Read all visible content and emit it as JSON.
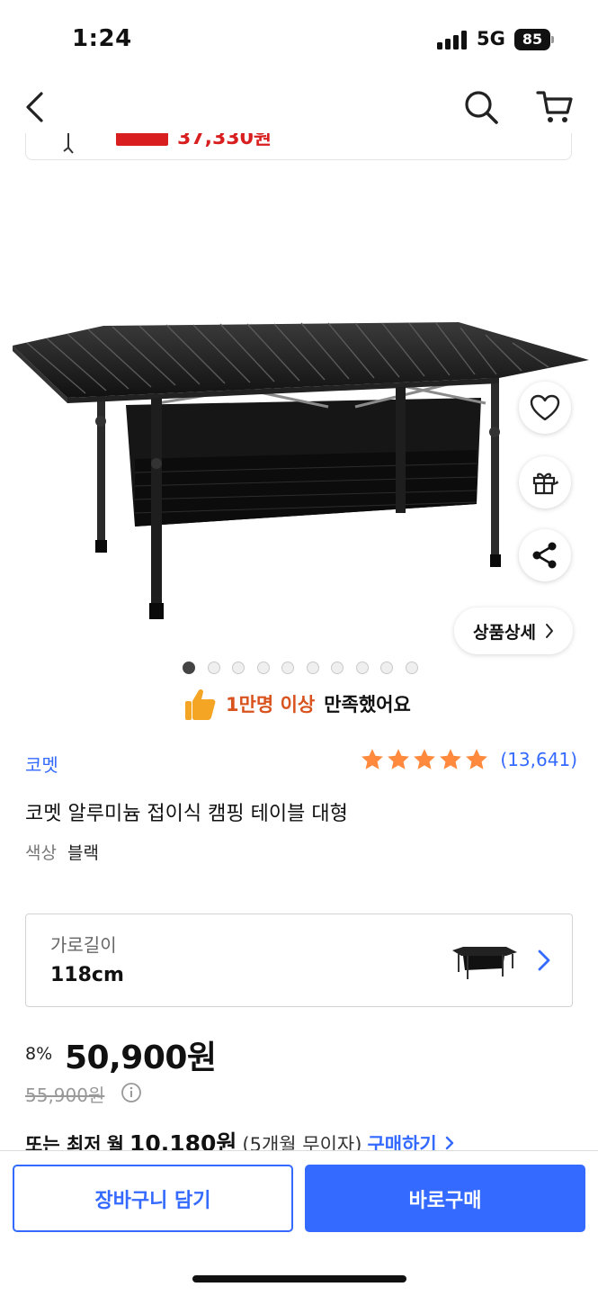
{
  "status": {
    "time": "1:24",
    "network": "5G",
    "battery": "85"
  },
  "peek": {
    "price_text": "37,330원"
  },
  "side_actions": [
    "heart-icon",
    "gift-icon",
    "share-icon"
  ],
  "detail_button": {
    "label": "상품상세"
  },
  "gallery": {
    "total": 10,
    "active_index": 0
  },
  "satisfaction": {
    "highlight": "1만명 이상",
    "text": "만족했어요"
  },
  "product": {
    "brand": "코멧",
    "rating_stars": 5,
    "review_count": "(13,641)",
    "title": "코멧 알루미늄 접이식 캠핑 테이블 대형",
    "color_label": "색상",
    "color_value": "블랙"
  },
  "option": {
    "label": "가로길이",
    "value": "118cm"
  },
  "price": {
    "discount": "8%",
    "sale": "50,900원",
    "original": "55,900원"
  },
  "installment": {
    "prefix": "또는 최저",
    "month_word": "월",
    "amount": "10,180원",
    "note": "(5개월 무이자)",
    "link": "구매하기"
  },
  "actions": {
    "cart": "장바구니 담기",
    "buy": "바로구매"
  },
  "colors": {
    "accent": "#346aff",
    "star": "#ff8a3d",
    "sale_red": "#d81e1e",
    "highlight": "#d9531e"
  }
}
